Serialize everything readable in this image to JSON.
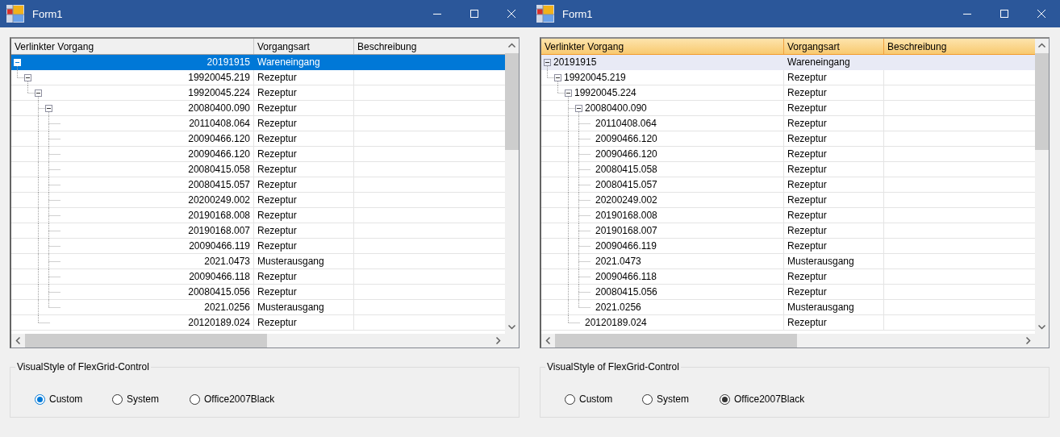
{
  "windows": [
    {
      "title": "Form1",
      "grid": {
        "kind": "custom",
        "columns": [
          "Verlinkter Vorgang",
          "Vorgangsart",
          "Beschreibung"
        ],
        "rows": [
          {
            "label": "20191915",
            "type": "Wareneingang",
            "selected": true,
            "expanded": true,
            "children": [
              {
                "label": "19920045.219",
                "type": "Rezeptur",
                "selected": false,
                "expanded": true,
                "children": [
                  {
                    "label": "19920045.224",
                    "type": "Rezeptur",
                    "selected": false,
                    "expanded": true,
                    "children": [
                      {
                        "label": "20080400.090",
                        "type": "Rezeptur",
                        "selected": false,
                        "expanded": true,
                        "children": [
                          {
                            "label": "20110408.064",
                            "type": "Rezeptur",
                            "selected": false
                          },
                          {
                            "label": "20090466.120",
                            "type": "Rezeptur",
                            "selected": false
                          },
                          {
                            "label": "20090466.120",
                            "type": "Rezeptur",
                            "selected": false
                          },
                          {
                            "label": "20080415.058",
                            "type": "Rezeptur",
                            "selected": false
                          },
                          {
                            "label": "20080415.057",
                            "type": "Rezeptur",
                            "selected": false
                          },
                          {
                            "label": "20200249.002",
                            "type": "Rezeptur",
                            "selected": false
                          },
                          {
                            "label": "20190168.008",
                            "type": "Rezeptur",
                            "selected": false
                          },
                          {
                            "label": "20190168.007",
                            "type": "Rezeptur",
                            "selected": false
                          },
                          {
                            "label": "20090466.119",
                            "type": "Rezeptur",
                            "selected": false
                          },
                          {
                            "label": "2021.0473",
                            "type": "Musterausgang",
                            "selected": false
                          },
                          {
                            "label": "20090466.118",
                            "type": "Rezeptur",
                            "selected": false
                          },
                          {
                            "label": "20080415.056",
                            "type": "Rezeptur",
                            "selected": false
                          },
                          {
                            "label": "2021.0256",
                            "type": "Musterausgang",
                            "selected": false
                          }
                        ]
                      },
                      {
                        "label": "20120189.024",
                        "type": "Rezeptur",
                        "selected": false
                      }
                    ]
                  }
                ]
              }
            ]
          }
        ]
      },
      "group": {
        "legend": "VisualStyle of FlexGrid-Control",
        "options": [
          {
            "label": "Custom",
            "selected": true
          },
          {
            "label": "System",
            "selected": false
          },
          {
            "label": "Office2007Black",
            "selected": false
          }
        ]
      }
    },
    {
      "title": "Form1",
      "grid": {
        "kind": "office2007black",
        "columns": [
          "Verlinkter Vorgang",
          "Vorgangsart",
          "Beschreibung"
        ],
        "rows": [
          {
            "label": "20191915",
            "type": "Wareneingang",
            "selected": true,
            "expanded": true,
            "children": [
              {
                "label": "19920045.219",
                "type": "Rezeptur",
                "selected": false,
                "expanded": true,
                "children": [
                  {
                    "label": "19920045.224",
                    "type": "Rezeptur",
                    "selected": false,
                    "expanded": true,
                    "children": [
                      {
                        "label": "20080400.090",
                        "type": "Rezeptur",
                        "selected": false,
                        "expanded": true,
                        "children": [
                          {
                            "label": "20110408.064",
                            "type": "Rezeptur",
                            "selected": false
                          },
                          {
                            "label": "20090466.120",
                            "type": "Rezeptur",
                            "selected": false
                          },
                          {
                            "label": "20090466.120",
                            "type": "Rezeptur",
                            "selected": false
                          },
                          {
                            "label": "20080415.058",
                            "type": "Rezeptur",
                            "selected": false
                          },
                          {
                            "label": "20080415.057",
                            "type": "Rezeptur",
                            "selected": false
                          },
                          {
                            "label": "20200249.002",
                            "type": "Rezeptur",
                            "selected": false
                          },
                          {
                            "label": "20190168.008",
                            "type": "Rezeptur",
                            "selected": false
                          },
                          {
                            "label": "20190168.007",
                            "type": "Rezeptur",
                            "selected": false
                          },
                          {
                            "label": "20090466.119",
                            "type": "Rezeptur",
                            "selected": false
                          },
                          {
                            "label": "2021.0473",
                            "type": "Musterausgang",
                            "selected": false
                          },
                          {
                            "label": "20090466.118",
                            "type": "Rezeptur",
                            "selected": false
                          },
                          {
                            "label": "20080415.056",
                            "type": "Rezeptur",
                            "selected": false
                          },
                          {
                            "label": "2021.0256",
                            "type": "Musterausgang",
                            "selected": false
                          }
                        ]
                      },
                      {
                        "label": "20120189.024",
                        "type": "Rezeptur",
                        "selected": false
                      }
                    ]
                  }
                ]
              }
            ]
          }
        ]
      },
      "group": {
        "legend": "VisualStyle of FlexGrid-Control",
        "options": [
          {
            "label": "Custom",
            "selected": false
          },
          {
            "label": "System",
            "selected": false
          },
          {
            "label": "Office2007Black",
            "selected": true
          }
        ]
      }
    }
  ]
}
